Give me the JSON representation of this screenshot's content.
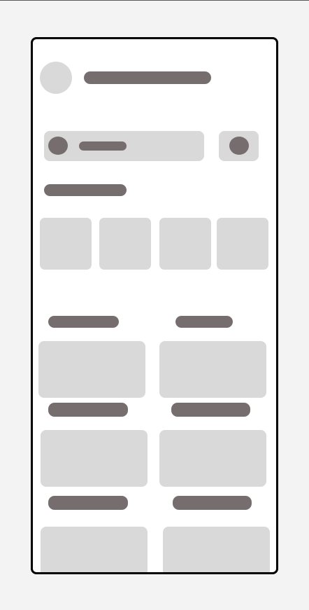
{
  "screen": {
    "style": "wireframe skeleton",
    "colors": {
      "background": "#f3f3f3",
      "frame": "#000000",
      "placeholder": "#d9d9d9",
      "text_bar": "#766e6e"
    },
    "header": {
      "avatar_icon": "avatar-placeholder",
      "title_text": ""
    },
    "search": {
      "placeholder": "",
      "leading_icon": "search-icon",
      "trailing_icon": "filter-icon"
    },
    "categories": {
      "section_title": "",
      "items": [
        "",
        "",
        "",
        ""
      ]
    },
    "grid": {
      "items": [
        {
          "title": "",
          "caption": ""
        },
        {
          "title": "",
          "caption": ""
        },
        {
          "title": "",
          "caption": ""
        },
        {
          "title": "",
          "caption": ""
        },
        {
          "title": "",
          "caption": ""
        },
        {
          "title": "",
          "caption": ""
        }
      ]
    }
  }
}
